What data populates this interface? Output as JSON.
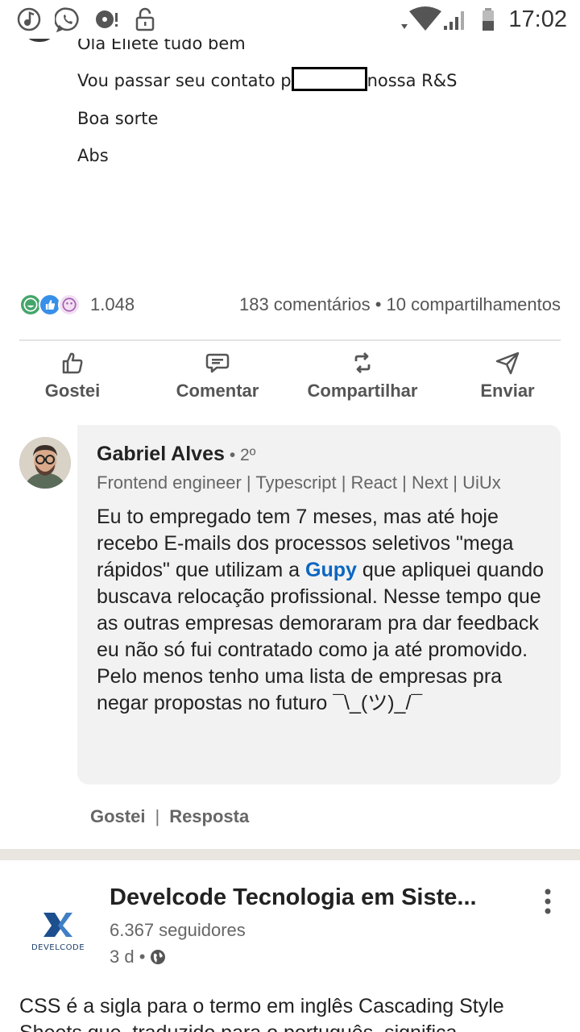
{
  "status_bar": {
    "time": "17:02"
  },
  "post": {
    "lines": [
      "Ola Eliete tudo bem",
      "Vou passar seu contato p",
      "nossa R&S",
      "Boa sorte",
      "Abs"
    ]
  },
  "social": {
    "reactions_count": "1.048",
    "comments_shares": "183 comentários • 10 compartilhamentos"
  },
  "actions": {
    "like": "Gostei",
    "comment": "Comentar",
    "share": "Compartilhar",
    "send": "Enviar"
  },
  "comment": {
    "author": "Gabriel Alves",
    "degree": "• 2º",
    "headline": "Frontend engineer | Typescript | React | Next | UiUx",
    "text_before": "Eu to empregado tem 7 meses, mas até hoje recebo E-mails dos processos seletivos \"mega rápidos\" que utilizam a ",
    "mention": "Gupy",
    "text_after": " que apliquei quando buscava relocação profissional. Nesse tempo que as outras empresas demoraram pra dar feedback eu não só fui contratado como ja até promovido.",
    "text_line2": "Pelo menos tenho uma lista de empresas pra negar propostas no futuro ¯\\_(ツ)_/¯",
    "like_label": "Gostei",
    "separator": "|",
    "reply_label": "Resposta"
  },
  "next_post": {
    "company": "Develcode Tecnologia em Siste...",
    "logo_text": "DEVELCODE",
    "followers": "6.367 seguidores",
    "age": "3 d •",
    "text": "CSS é a sigla para o termo em inglês Cascading Style Sheets que, traduzido para o português, significa"
  },
  "colors": {
    "accent": "#0a66c2",
    "bubble": "#f2f2f2",
    "muted": "#666666"
  }
}
